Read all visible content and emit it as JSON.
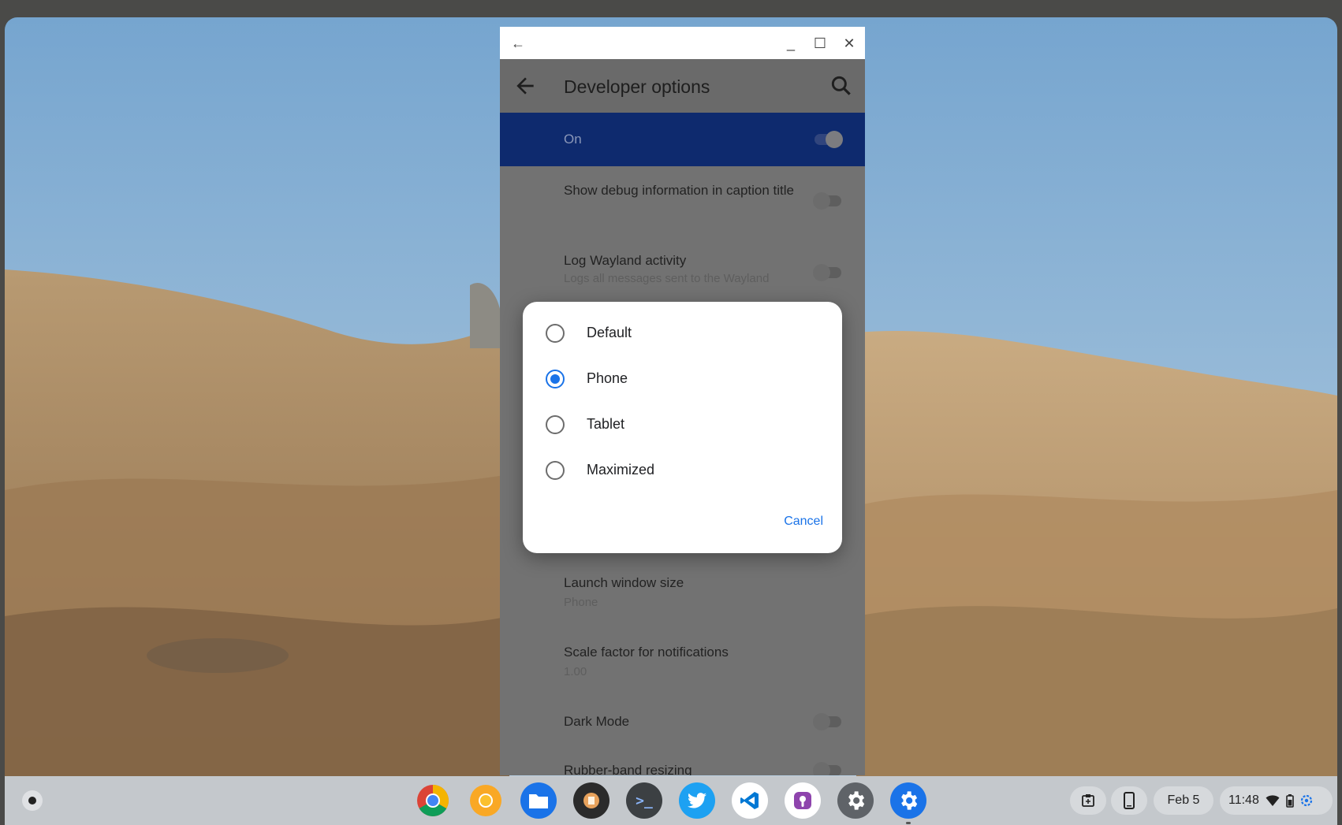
{
  "window": {
    "title": "Developer options",
    "buttons": {
      "back": "←",
      "minimize": "_",
      "maximize": "☐",
      "close": "✕"
    }
  },
  "master_switch": {
    "label": "On",
    "enabled": true
  },
  "settings": [
    {
      "title": "Show debug information in caption title",
      "subtitle": "",
      "has_toggle": true,
      "on": false
    },
    {
      "title": "Log Wayland activity",
      "subtitle": "Logs all messages sent to the Wayland",
      "has_toggle": true,
      "on": false
    },
    {
      "title": "Launch window size",
      "subtitle": "Phone",
      "has_toggle": false
    },
    {
      "title": "Scale factor for notifications",
      "subtitle": "1.00",
      "has_toggle": false
    },
    {
      "title": "Dark Mode",
      "subtitle": "",
      "has_toggle": true,
      "on": false
    },
    {
      "title": "Rubber-band resizing",
      "subtitle": "",
      "has_toggle": true,
      "on": false
    }
  ],
  "dialog": {
    "options": [
      "Default",
      "Phone",
      "Tablet",
      "Maximized"
    ],
    "selected": "Phone",
    "cancel_label": "Cancel"
  },
  "shelf": {
    "apps": [
      "chrome-icon",
      "chrome-canary-icon",
      "files-icon",
      "game-icon",
      "terminal-icon",
      "twitter-icon",
      "vscode-icon",
      "podcast-icon",
      "settings-icon",
      "android-settings-icon"
    ],
    "tray": {
      "date": "Feb 5",
      "time": "11:48"
    }
  },
  "colors": {
    "accent": "#1a73e8",
    "master_bar": "#0e2a6e",
    "sky": "#8cb6d8"
  }
}
